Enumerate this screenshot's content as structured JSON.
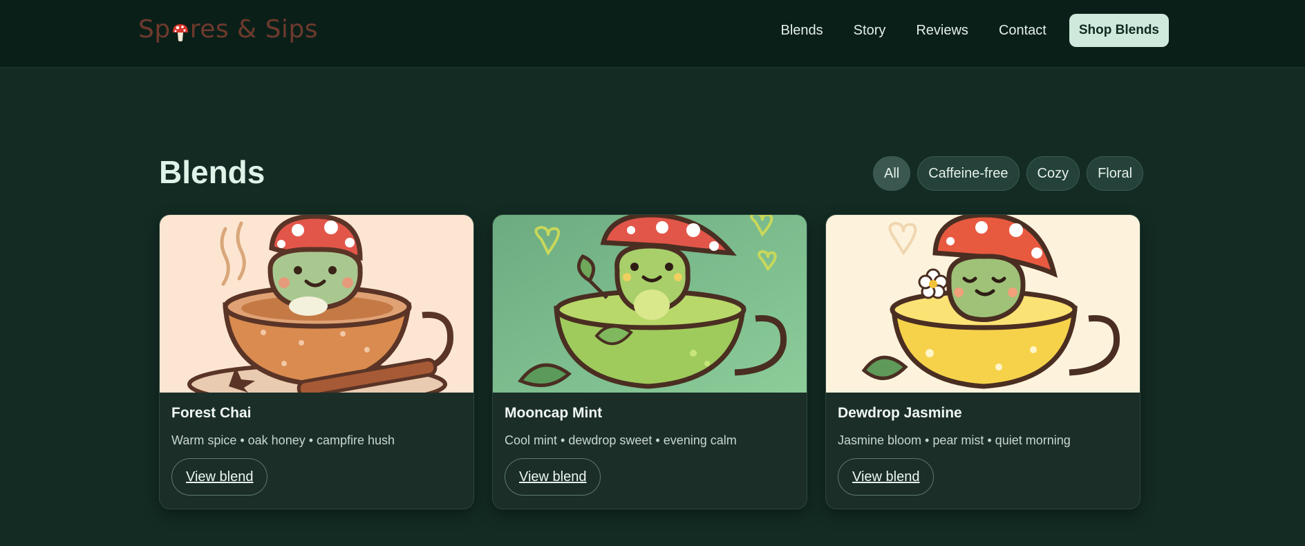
{
  "header": {
    "logo_part1": "Sp",
    "logo_part2": "res & Sips",
    "logo_icon": "mushroom-icon",
    "nav": [
      "Blends",
      "Story",
      "Reviews",
      "Contact"
    ],
    "cta": "Shop Blends"
  },
  "section": {
    "title": "Blends",
    "filters": [
      "All",
      "Caffeine-free",
      "Cozy",
      "Floral"
    ],
    "active_filter": "All"
  },
  "cards": [
    {
      "title": "Forest Chai",
      "desc": "Warm spice • oak honey • campfire hush",
      "button": "View blend",
      "image_icon": "frog-in-chai-cup-illustration"
    },
    {
      "title": "Mooncap Mint",
      "desc": "Cool mint • dewdrop sweet • evening calm",
      "button": "View blend",
      "image_icon": "frog-in-mint-cup-illustration"
    },
    {
      "title": "Dewdrop Jasmine",
      "desc": "Jasmine bloom • pear mist • quiet morning",
      "button": "View blend",
      "image_icon": "frog-in-jasmine-cup-illustration"
    }
  ],
  "colors": {
    "background": "#132b23",
    "header": "#0b1f19",
    "logo": "#6e3a2c",
    "cta_bg": "#cfe9dc",
    "card_bg": "#1b2e27"
  }
}
